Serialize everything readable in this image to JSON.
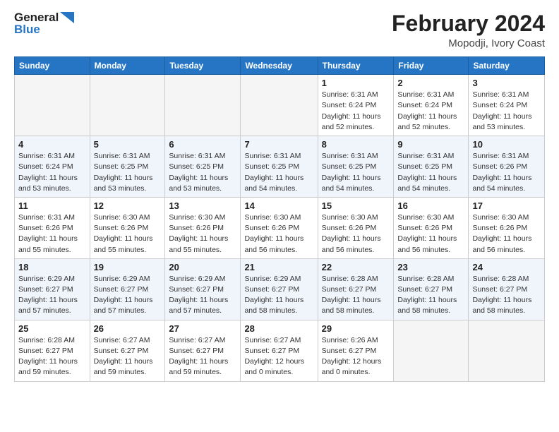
{
  "header": {
    "logo_line1": "General",
    "logo_line2": "Blue",
    "title": "February 2024",
    "subtitle": "Mopodji, Ivory Coast"
  },
  "days_of_week": [
    "Sunday",
    "Monday",
    "Tuesday",
    "Wednesday",
    "Thursday",
    "Friday",
    "Saturday"
  ],
  "weeks": [
    [
      {
        "day": "",
        "info": ""
      },
      {
        "day": "",
        "info": ""
      },
      {
        "day": "",
        "info": ""
      },
      {
        "day": "",
        "info": ""
      },
      {
        "day": "1",
        "info": "Sunrise: 6:31 AM\nSunset: 6:24 PM\nDaylight: 11 hours\nand 52 minutes."
      },
      {
        "day": "2",
        "info": "Sunrise: 6:31 AM\nSunset: 6:24 PM\nDaylight: 11 hours\nand 52 minutes."
      },
      {
        "day": "3",
        "info": "Sunrise: 6:31 AM\nSunset: 6:24 PM\nDaylight: 11 hours\nand 53 minutes."
      }
    ],
    [
      {
        "day": "4",
        "info": "Sunrise: 6:31 AM\nSunset: 6:24 PM\nDaylight: 11 hours\nand 53 minutes."
      },
      {
        "day": "5",
        "info": "Sunrise: 6:31 AM\nSunset: 6:25 PM\nDaylight: 11 hours\nand 53 minutes."
      },
      {
        "day": "6",
        "info": "Sunrise: 6:31 AM\nSunset: 6:25 PM\nDaylight: 11 hours\nand 53 minutes."
      },
      {
        "day": "7",
        "info": "Sunrise: 6:31 AM\nSunset: 6:25 PM\nDaylight: 11 hours\nand 54 minutes."
      },
      {
        "day": "8",
        "info": "Sunrise: 6:31 AM\nSunset: 6:25 PM\nDaylight: 11 hours\nand 54 minutes."
      },
      {
        "day": "9",
        "info": "Sunrise: 6:31 AM\nSunset: 6:25 PM\nDaylight: 11 hours\nand 54 minutes."
      },
      {
        "day": "10",
        "info": "Sunrise: 6:31 AM\nSunset: 6:26 PM\nDaylight: 11 hours\nand 54 minutes."
      }
    ],
    [
      {
        "day": "11",
        "info": "Sunrise: 6:31 AM\nSunset: 6:26 PM\nDaylight: 11 hours\nand 55 minutes."
      },
      {
        "day": "12",
        "info": "Sunrise: 6:30 AM\nSunset: 6:26 PM\nDaylight: 11 hours\nand 55 minutes."
      },
      {
        "day": "13",
        "info": "Sunrise: 6:30 AM\nSunset: 6:26 PM\nDaylight: 11 hours\nand 55 minutes."
      },
      {
        "day": "14",
        "info": "Sunrise: 6:30 AM\nSunset: 6:26 PM\nDaylight: 11 hours\nand 56 minutes."
      },
      {
        "day": "15",
        "info": "Sunrise: 6:30 AM\nSunset: 6:26 PM\nDaylight: 11 hours\nand 56 minutes."
      },
      {
        "day": "16",
        "info": "Sunrise: 6:30 AM\nSunset: 6:26 PM\nDaylight: 11 hours\nand 56 minutes."
      },
      {
        "day": "17",
        "info": "Sunrise: 6:30 AM\nSunset: 6:26 PM\nDaylight: 11 hours\nand 56 minutes."
      }
    ],
    [
      {
        "day": "18",
        "info": "Sunrise: 6:29 AM\nSunset: 6:27 PM\nDaylight: 11 hours\nand 57 minutes."
      },
      {
        "day": "19",
        "info": "Sunrise: 6:29 AM\nSunset: 6:27 PM\nDaylight: 11 hours\nand 57 minutes."
      },
      {
        "day": "20",
        "info": "Sunrise: 6:29 AM\nSunset: 6:27 PM\nDaylight: 11 hours\nand 57 minutes."
      },
      {
        "day": "21",
        "info": "Sunrise: 6:29 AM\nSunset: 6:27 PM\nDaylight: 11 hours\nand 58 minutes."
      },
      {
        "day": "22",
        "info": "Sunrise: 6:28 AM\nSunset: 6:27 PM\nDaylight: 11 hours\nand 58 minutes."
      },
      {
        "day": "23",
        "info": "Sunrise: 6:28 AM\nSunset: 6:27 PM\nDaylight: 11 hours\nand 58 minutes."
      },
      {
        "day": "24",
        "info": "Sunrise: 6:28 AM\nSunset: 6:27 PM\nDaylight: 11 hours\nand 58 minutes."
      }
    ],
    [
      {
        "day": "25",
        "info": "Sunrise: 6:28 AM\nSunset: 6:27 PM\nDaylight: 11 hours\nand 59 minutes."
      },
      {
        "day": "26",
        "info": "Sunrise: 6:27 AM\nSunset: 6:27 PM\nDaylight: 11 hours\nand 59 minutes."
      },
      {
        "day": "27",
        "info": "Sunrise: 6:27 AM\nSunset: 6:27 PM\nDaylight: 11 hours\nand 59 minutes."
      },
      {
        "day": "28",
        "info": "Sunrise: 6:27 AM\nSunset: 6:27 PM\nDaylight: 12 hours\nand 0 minutes."
      },
      {
        "day": "29",
        "info": "Sunrise: 6:26 AM\nSunset: 6:27 PM\nDaylight: 12 hours\nand 0 minutes."
      },
      {
        "day": "",
        "info": ""
      },
      {
        "day": "",
        "info": ""
      }
    ]
  ]
}
